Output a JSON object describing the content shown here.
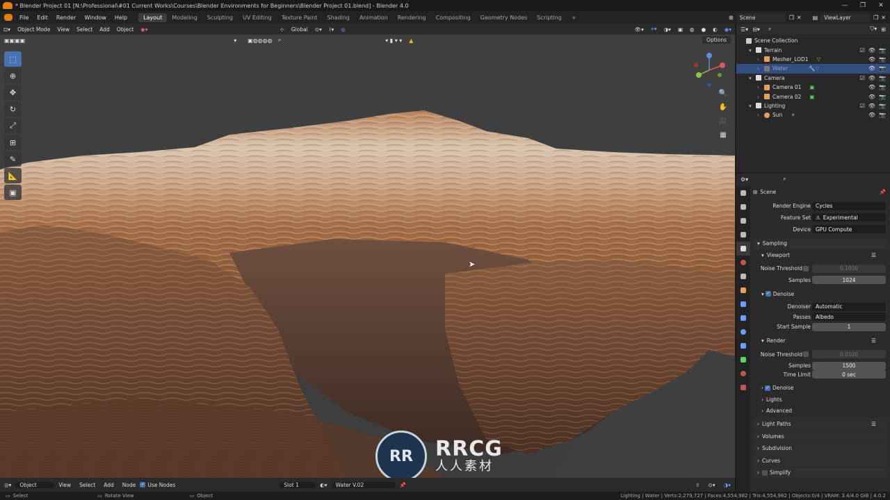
{
  "window": {
    "title": "* Blender Project 01 [N:\\Professional\\#01 Current Works\\Courses\\Blender Environments for Beginners\\Blender Project 01.blend] - Blender 4.0"
  },
  "menu": [
    "File",
    "Edit",
    "Render",
    "Window",
    "Help"
  ],
  "workspaces": [
    "Layout",
    "Modeling",
    "Sculpting",
    "UV Editing",
    "Texture Paint",
    "Shading",
    "Animation",
    "Rendering",
    "Compositing",
    "Geometry Nodes",
    "Scripting"
  ],
  "active_workspace": "Layout",
  "scene_field": "Scene",
  "viewlayer_field": "ViewLayer",
  "viewport": {
    "mode": "Object Mode",
    "menus": [
      "View",
      "Select",
      "Add",
      "Object"
    ],
    "transform": "Global",
    "options": "Options"
  },
  "bottom_editor": {
    "editor_type": "Object",
    "menus": [
      "View",
      "Select",
      "Add",
      "Node"
    ],
    "use_nodes": "Use Nodes",
    "slot": "Slot 1",
    "material": "Water V.02"
  },
  "status_bar": {
    "left_items": [
      "Select",
      "Rotate View",
      "Object"
    ],
    "stats": "Lighting | Water | Verts:2,279,727 | Faces:4,554,982 | Tris:4,554,982 | Objects:0/4 | VRAM: 3.4/4.0 GiB | 4.0.2"
  },
  "outliner": {
    "root": "Scene Collection",
    "items": [
      {
        "name": "Terrain",
        "level": 1,
        "type": "collection"
      },
      {
        "name": "Mesher_LOD1",
        "level": 2,
        "type": "mesh"
      },
      {
        "name": "Water",
        "level": 2,
        "type": "mesh",
        "selected": true
      },
      {
        "name": "Camera",
        "level": 1,
        "type": "collection"
      },
      {
        "name": "Camera 01",
        "level": 2,
        "type": "camera"
      },
      {
        "name": "Camera 02",
        "level": 2,
        "type": "camera"
      },
      {
        "name": "Lighting",
        "level": 1,
        "type": "collection"
      },
      {
        "name": "Sun",
        "level": 2,
        "type": "light"
      }
    ]
  },
  "properties": {
    "context": "Scene",
    "render_engine_label": "Render Engine",
    "render_engine": "Cycles",
    "feature_set_label": "Feature Set",
    "feature_set": "Experimental",
    "device_label": "Device",
    "device": "GPU Compute",
    "sampling": "Sampling",
    "viewport_section": "Viewport",
    "vp_noise_threshold_label": "Noise Threshold",
    "vp_noise_threshold": "0.1000",
    "vp_samples_label": "Samples",
    "vp_samples": "1024",
    "vp_denoise": "Denoise",
    "denoiser_label": "Denoiser",
    "denoiser": "Automatic",
    "passes_label": "Passes",
    "passes": "Albedo",
    "start_sample_label": "Start Sample",
    "start_sample": "1",
    "render_section": "Render",
    "r_noise_threshold_label": "Noise Threshold",
    "r_noise_threshold": "0.0100",
    "r_samples_label": "Samples",
    "r_samples": "1500",
    "time_limit_label": "Time Limit",
    "time_limit": "0 sec",
    "r_denoise": "Denoise",
    "lights": "Lights",
    "advanced": "Advanced",
    "light_paths": "Light Paths",
    "volumes": "Volumes",
    "subdivision": "Subdivision",
    "curves": "Curves",
    "simplify": "Simplify"
  },
  "watermark": {
    "text": "RRCG",
    "subtext": "人人素材"
  },
  "colors": {
    "accent": "#4772b3",
    "blender_orange": "#e87d0d",
    "selection": "#334d80"
  }
}
